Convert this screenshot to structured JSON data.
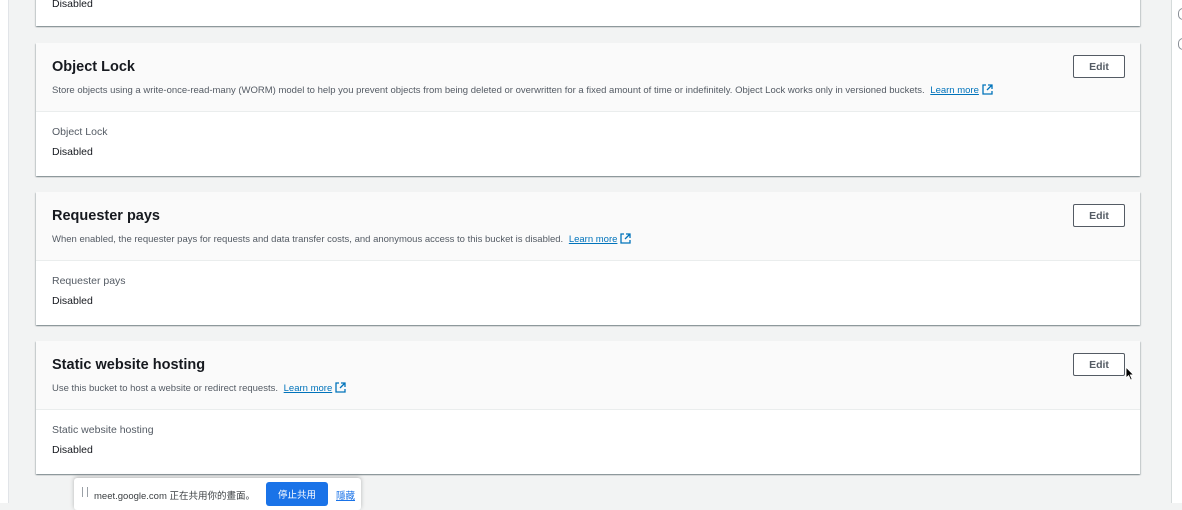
{
  "top_section": {
    "value": "Disabled"
  },
  "sections": [
    {
      "title": "Object Lock",
      "description": "Store objects using a write-once-read-many (WORM) model to help you prevent objects from being deleted or overwritten for a fixed amount of time or indefinitely. Object Lock works only in versioned buckets.",
      "learn_more": "Learn more",
      "edit_label": "Edit",
      "field_label": "Object Lock",
      "field_value": "Disabled"
    },
    {
      "title": "Requester pays",
      "description": "When enabled, the requester pays for requests and data transfer costs, and anonymous access to this bucket is disabled.",
      "learn_more": "Learn more",
      "edit_label": "Edit",
      "field_label": "Requester pays",
      "field_value": "Disabled"
    },
    {
      "title": "Static website hosting",
      "description": "Use this bucket to host a website or redirect requests.",
      "learn_more": "Learn more",
      "edit_label": "Edit",
      "field_label": "Static website hosting",
      "field_value": "Disabled"
    }
  ],
  "share_bar": {
    "message": "meet.google.com 正在共用你的畫面。",
    "stop_label": "停止共用",
    "hide_label": "隱藏"
  },
  "colors": {
    "link": "#0073bb",
    "page_bg": "#f2f3f3",
    "share_button": "#1a73e8"
  },
  "icons": [
    "external-link-icon",
    "mouse-pointer-icon",
    "drag-handle-icon"
  ]
}
